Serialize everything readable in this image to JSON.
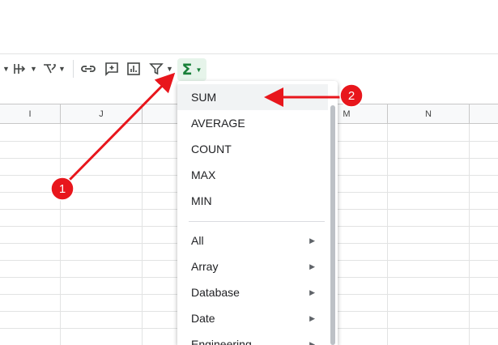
{
  "columns": [
    "I",
    "J",
    "M",
    "N"
  ],
  "sum_button": {
    "symbol": "Σ",
    "active_color": "#188038"
  },
  "functions_menu": {
    "basic": [
      "SUM",
      "AVERAGE",
      "COUNT",
      "MAX",
      "MIN"
    ],
    "categories": [
      "All",
      "Array",
      "Database",
      "Date",
      "Engineering"
    ],
    "highlighted": "SUM"
  },
  "annotations": [
    {
      "label": "1",
      "color": "#e8161c"
    },
    {
      "label": "2",
      "color": "#e8161c"
    }
  ]
}
